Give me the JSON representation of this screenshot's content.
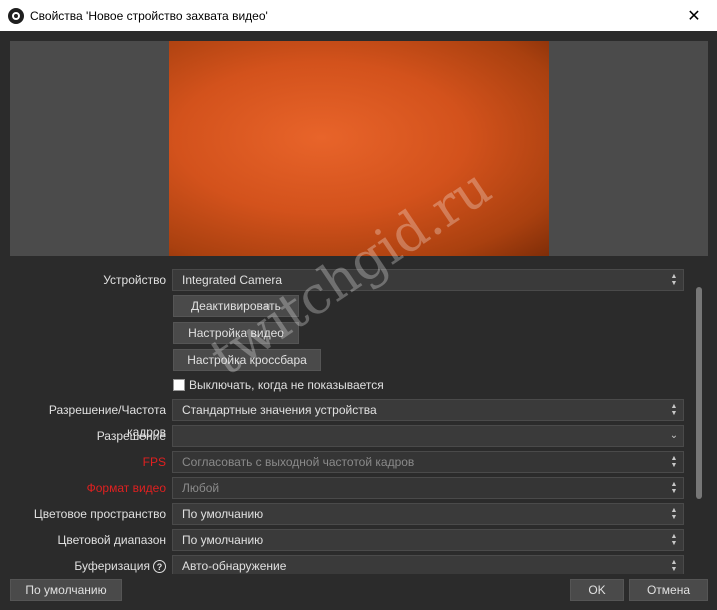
{
  "window": {
    "title": "Свойства 'Новое стройство захвата видео'",
    "close_glyph": "✕"
  },
  "colors": {
    "accent_red": "#e02020",
    "background": "#2b2b2b",
    "field_bg": "#3a3a3a"
  },
  "properties": {
    "device": {
      "label": "Устройство",
      "value": "Integrated Camera"
    },
    "deactivate_button": "Деактивировать",
    "video_settings_button": "Настройка видео",
    "crossbar_settings_button": "Настройка кроссбара",
    "hide_when_not_shown": {
      "label": "Выключать, когда не показывается",
      "checked": false
    },
    "resolution_fps_type": {
      "label": "Разрешение/Частота кадров",
      "value": "Стандартные значения устройства"
    },
    "resolution": {
      "label": "Разрешение",
      "value": ""
    },
    "fps": {
      "label": "FPS",
      "value": "Согласовать с выходной частотой кадров"
    },
    "video_format": {
      "label": "Формат видео",
      "value": "Любой"
    },
    "color_space": {
      "label": "Цветовое пространство",
      "value": "По умолчанию"
    },
    "color_range": {
      "label": "Цветовой диапазон",
      "value": "По умолчанию"
    },
    "buffering": {
      "label": "Буферизация",
      "value": "Авто-обнаружение",
      "help_glyph": "?"
    }
  },
  "footer": {
    "defaults_button": "По умолчанию",
    "ok_button": "OK",
    "cancel_button": "Отмена"
  },
  "watermark": "twitchgid.ru"
}
